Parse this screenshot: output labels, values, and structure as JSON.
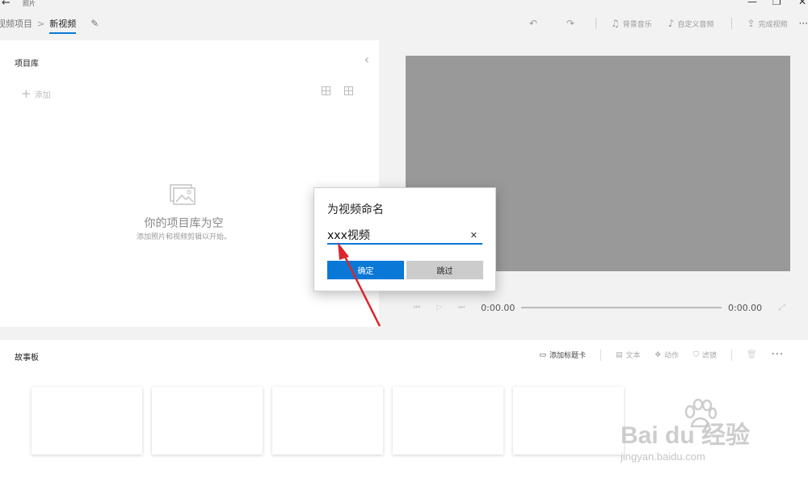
{
  "window": {
    "app_title": "照片",
    "back_icon": "←",
    "minimize_icon": "—",
    "restore_icon": "❐",
    "close_icon": "✕"
  },
  "breadcrumb": {
    "root": "视频项目",
    "separator": ">",
    "current": "新视频",
    "edit_icon": "✎"
  },
  "toolbar": {
    "undo_icon": "↶",
    "redo_icon": "↷",
    "music_icon": "♫",
    "music_label": "背景音乐",
    "custom_audio_icon": "♪",
    "custom_audio_label": "自定义音频",
    "finish_icon": "⇪",
    "finish_label": "完成视频",
    "more_icon": "···"
  },
  "library": {
    "title": "项目库",
    "collapse_icon": "‹",
    "add_icon": "+",
    "add_label": "添加",
    "empty_title": "你的项目库为空",
    "empty_subtitle": "添加照片和视频剪辑以开始。"
  },
  "player": {
    "prev_icon": "⏮",
    "play_icon": "▷",
    "next_icon": "⏭",
    "current_time": "0:00.00",
    "total_time": "0:00.00",
    "fullscreen_icon": "⤢"
  },
  "storyboard": {
    "title": "故事板",
    "tools": [
      {
        "icon": "▭",
        "label": "添加标题卡"
      },
      {
        "icon": "▤",
        "label": "文本"
      },
      {
        "icon": "✥",
        "label": "动作"
      },
      {
        "icon": "⛉",
        "label": "滤镜"
      }
    ],
    "delete_icon": "🗑",
    "more_icon": "···"
  },
  "dialog": {
    "title": "为视频命名",
    "input_value": "xxx视频",
    "clear_icon": "✕",
    "ok_label": "确定",
    "skip_label": "跳过"
  },
  "colors": {
    "accent": "#0a78d7",
    "annotation_arrow": "#d9262c",
    "preview_bg": "#999999"
  },
  "watermark": {
    "text": "Bai du 经验",
    "url": "jingyan.baidu.com"
  }
}
